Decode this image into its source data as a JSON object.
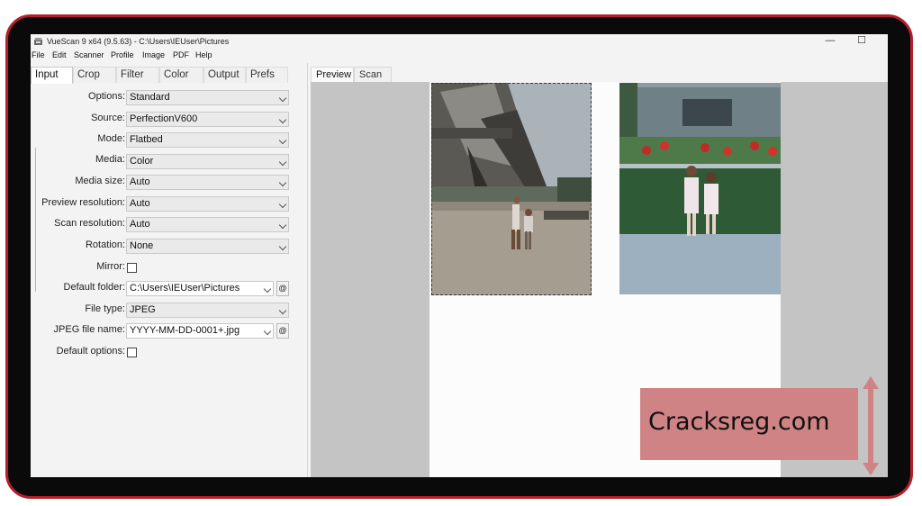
{
  "window": {
    "title": "VueScan 9 x64 (9.5.63) - C:\\Users\\IEUser\\Pictures",
    "minimize_glyph": "—",
    "maximize_glyph": "☐"
  },
  "menu": [
    "File",
    "Edit",
    "Scanner",
    "Profile",
    "Image",
    "PDF",
    "Help"
  ],
  "left_tabs": [
    "Input",
    "Crop",
    "Filter",
    "Color",
    "Output",
    "Prefs"
  ],
  "form": {
    "options_label": "Options:",
    "options_value": "Standard",
    "source_label": "Source:",
    "source_value": "PerfectionV600",
    "mode_label": "Mode:",
    "mode_value": "Flatbed",
    "media_label": "Media:",
    "media_value": "Color",
    "media_size_label": "Media size:",
    "media_size_value": "Auto",
    "preview_resolution_label": "Preview resolution:",
    "preview_resolution_value": "Auto",
    "scan_resolution_label": "Scan resolution:",
    "scan_resolution_value": "Auto",
    "rotation_label": "Rotation:",
    "rotation_value": "None",
    "mirror_label": "Mirror:",
    "default_folder_label": "Default folder:",
    "default_folder_value": "C:\\Users\\IEUser\\Pictures",
    "file_type_label": "File type:",
    "file_type_value": "JPEG",
    "jpeg_file_name_label": "JPEG file name:",
    "jpeg_file_name_value": "YYYY-MM-DD-0001+.jpg",
    "default_options_label": "Default options:",
    "browse_glyph": "@"
  },
  "preview_tabs": [
    "Preview",
    "Scan"
  ],
  "watermark": {
    "text": "Cracksreg.com"
  },
  "colors": {
    "frame_border": "#b3202a",
    "frame_bg": "#0a0a0a",
    "watermark_bg": "#d08385"
  },
  "icons": [
    "vuescan-app-icon",
    "chevron-down-icon",
    "checkbox-icon"
  ]
}
